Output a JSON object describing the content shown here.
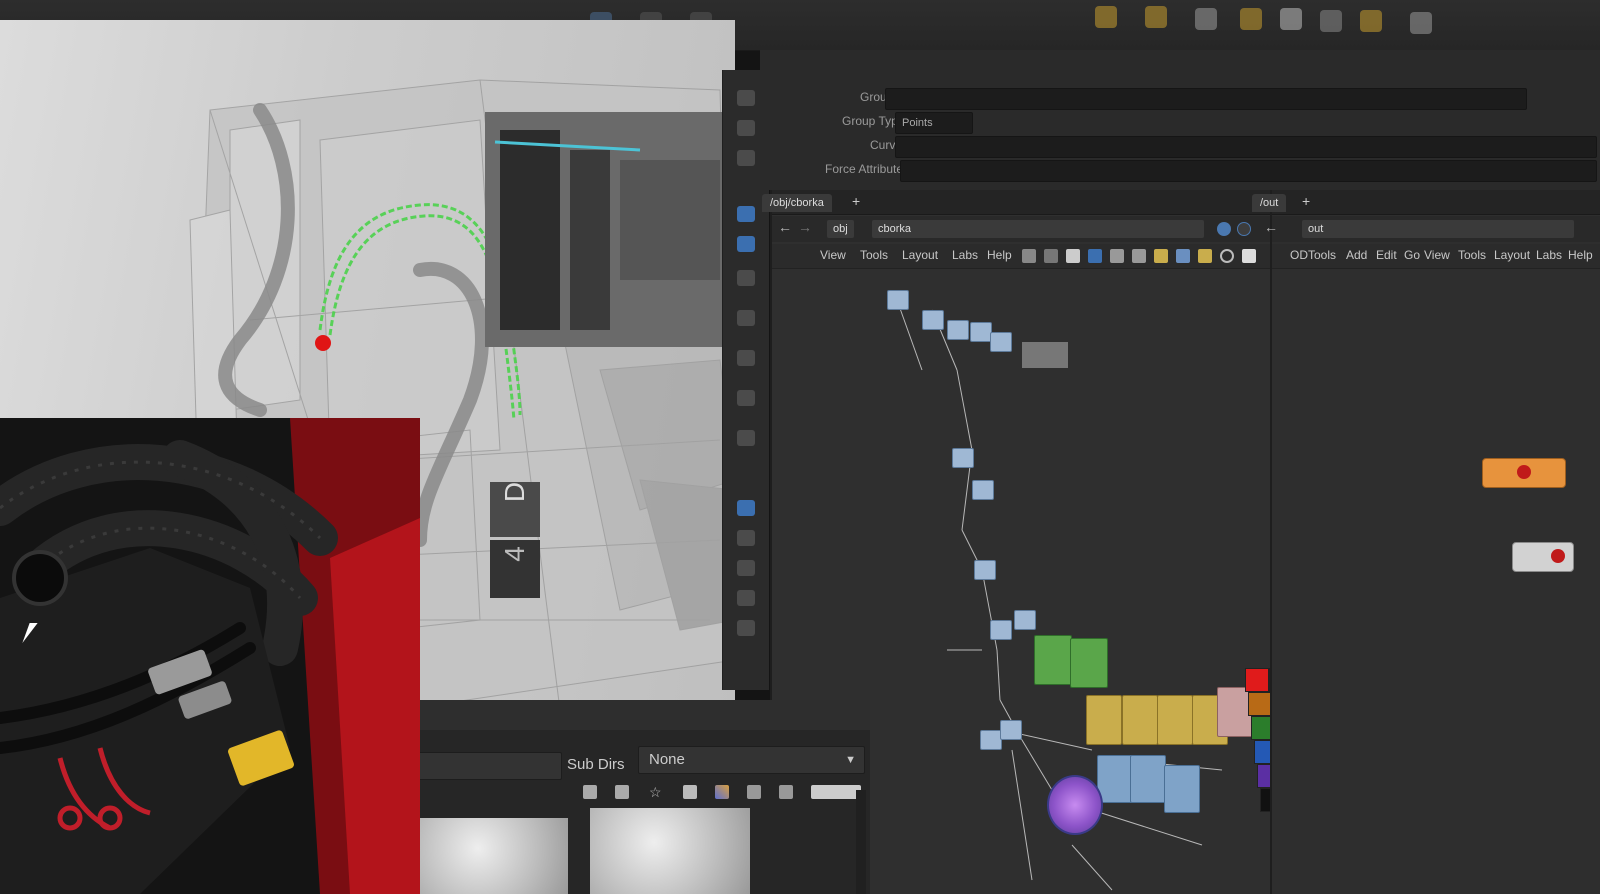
{
  "network": {
    "tab_label": "/obj/cborka",
    "path_root": "obj",
    "path_current": "cborka",
    "menus": [
      "View",
      "Tools",
      "Layout",
      "Labs",
      "Help"
    ]
  },
  "network2": {
    "tab_label": "/out",
    "path_current": "out",
    "menus": [
      "ODTools",
      "Add",
      "Edit",
      "Go",
      "View",
      "Tools",
      "Layout",
      "Labs",
      "Help"
    ]
  },
  "params": {
    "labels": [
      "Group",
      "Group Type",
      "Curves",
      "Force Attribute"
    ],
    "group_type_value": "Points"
  },
  "file_browser": {
    "subdirs_label": "Sub Dirs",
    "subdirs_value": "None"
  },
  "viewport": {
    "box_labels": [
      "D",
      "4"
    ]
  },
  "colors": {
    "accent_blue": "#3b6fb0",
    "node_green": "#5aa64a",
    "node_yellow": "#c9ad4c",
    "node_orange": "#e7933d",
    "selection_green": "#4cd24c"
  }
}
